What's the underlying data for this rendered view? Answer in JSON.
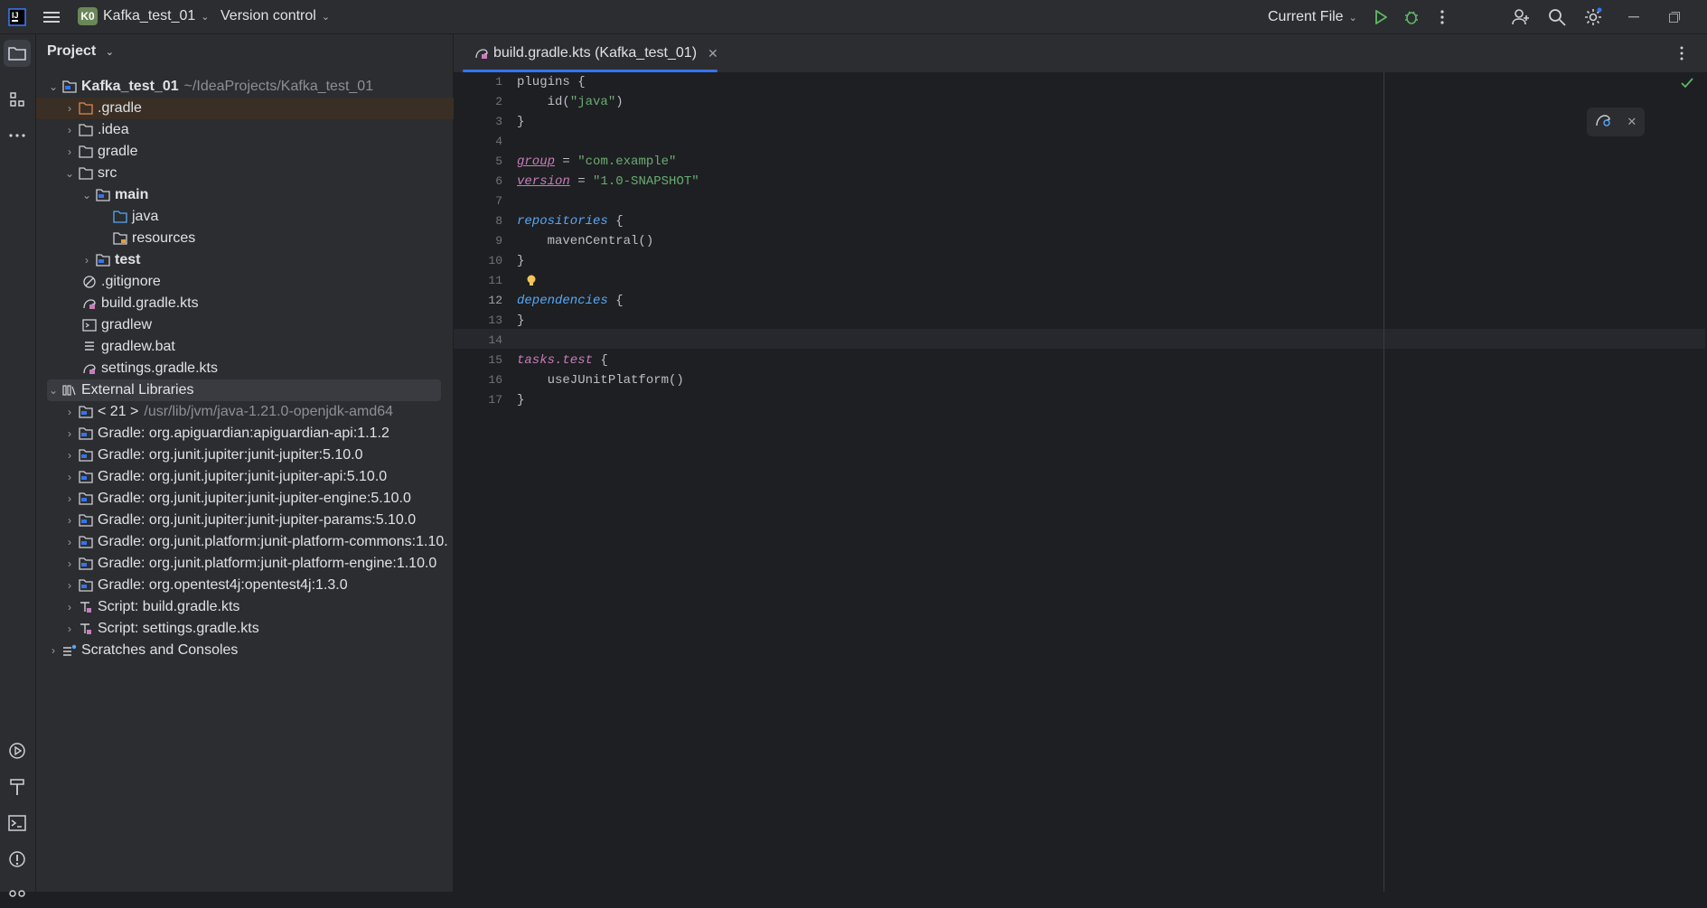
{
  "toolbar": {
    "project_badge": "K0",
    "project_name": "Kafka_test_01",
    "vcs_label": "Version control",
    "run_config": "Current File"
  },
  "project_panel": {
    "title": "Project",
    "tree": [
      {
        "label": "Kafka_test_01",
        "hint": "~/IdeaProjects/Kafka_test_01"
      },
      {
        "label": ".gradle"
      },
      {
        "label": ".idea"
      },
      {
        "label": "gradle"
      },
      {
        "label": "src"
      },
      {
        "label": "main"
      },
      {
        "label": "java"
      },
      {
        "label": "resources"
      },
      {
        "label": "test"
      },
      {
        "label": ".gitignore"
      },
      {
        "label": "build.gradle.kts"
      },
      {
        "label": "gradlew"
      },
      {
        "label": "gradlew.bat"
      },
      {
        "label": "settings.gradle.kts"
      },
      {
        "label": "External Libraries"
      },
      {
        "label": "< 21 >",
        "hint": "/usr/lib/jvm/java-1.21.0-openjdk-amd64"
      },
      {
        "label": "Gradle: org.apiguardian:apiguardian-api:1.1.2"
      },
      {
        "label": "Gradle: org.junit.jupiter:junit-jupiter:5.10.0"
      },
      {
        "label": "Gradle: org.junit.jupiter:junit-jupiter-api:5.10.0"
      },
      {
        "label": "Gradle: org.junit.jupiter:junit-jupiter-engine:5.10.0"
      },
      {
        "label": "Gradle: org.junit.jupiter:junit-jupiter-params:5.10.0"
      },
      {
        "label": "Gradle: org.junit.platform:junit-platform-commons:1.10."
      },
      {
        "label": "Gradle: org.junit.platform:junit-platform-engine:1.10.0"
      },
      {
        "label": "Gradle: org.opentest4j:opentest4j:1.3.0"
      },
      {
        "label": "Script: build.gradle.kts"
      },
      {
        "label": "Script: settings.gradle.kts"
      },
      {
        "label": "Scratches and Consoles"
      }
    ]
  },
  "editor": {
    "tab_title": "build.gradle.kts (Kafka_test_01)",
    "current_line": 12,
    "line_numbers": [
      "1",
      "2",
      "3",
      "4",
      "5",
      "6",
      "7",
      "8",
      "9",
      "10",
      "11",
      "12",
      "13",
      "14",
      "15",
      "16",
      "17"
    ],
    "code": {
      "l1_a": "plugins {",
      "l2_a": "    id(",
      "l2_str": "\"java\"",
      "l2_b": ")",
      "l3_a": "}",
      "l5_kw": "group",
      "l5_eq": " = ",
      "l5_str": "\"com.example\"",
      "l6_kw": "version",
      "l6_eq": " = ",
      "l6_str": "\"1.0-SNAPSHOT\"",
      "l8_kw": "repositories",
      "l8_b": " {",
      "l9_a": "    mavenCentral()",
      "l10_a": "}",
      "l12_kw": "dependencies",
      "l12_b": " {",
      "l13_a": "}",
      "l15_kw": "tasks.test",
      "l15_b": " {",
      "l16_a": "    useJUnitPlatform()",
      "l17_a": "}"
    }
  },
  "colors": {
    "accent": "#3574f0",
    "keyword_purple": "#c77dbb",
    "keyword_blue": "#56a8f5",
    "string_green": "#6aab73",
    "run_green": "#5fb865"
  }
}
